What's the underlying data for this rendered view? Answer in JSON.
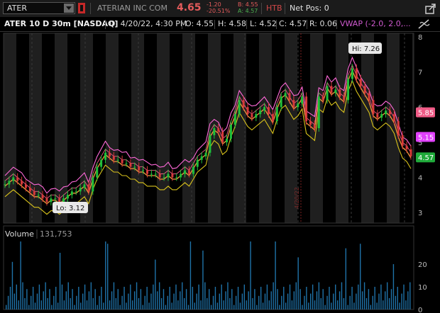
{
  "header": {
    "symbol": "ATER",
    "company": "ATERIAN INC COM",
    "last_price": "4.65",
    "change": "-1.20",
    "change_pct": "-20.51%",
    "bid": "B: 4.55",
    "ask": "A: 4.57",
    "htb": "HTB",
    "net_pos": "Net Pos: 0"
  },
  "info": {
    "title": "ATER 10 D 30m [NASDAQ]",
    "date": "D: 4/20/22, 4:30 PM",
    "open": "O: 4.55",
    "high": "H: 4.58",
    "low": "L: 4.52",
    "close": "C: 4.57",
    "range": "R: 0.06",
    "vwap": "VWAP (-2.0, 2.0,..."
  },
  "colors": {
    "up": "#1fbf3a",
    "down": "#d83a3a",
    "vwap": "#ff69d9",
    "orange": "#f39a3c",
    "yellow": "#d8c21c",
    "pink": "#f05a86",
    "cyan": "#1f72a8",
    "badge_pink": "#f05a86",
    "badge_magenta": "#e040fb",
    "badge_green": "#1faa3a"
  },
  "chart_data": [
    {
      "type": "line",
      "title": "ATER 10 D 30m [NASDAQ]",
      "ylim": [
        2.7,
        8.1
      ],
      "yticks": [
        3,
        4,
        5,
        6,
        7,
        8
      ],
      "x": [
        0,
        6,
        12,
        18,
        24,
        30,
        36,
        42,
        48,
        54,
        60,
        66,
        72,
        78,
        84,
        90,
        96,
        102,
        108,
        114,
        120,
        126,
        132,
        138,
        144,
        150,
        156,
        162,
        168,
        174,
        180,
        186,
        192,
        198,
        204,
        210,
        216,
        222,
        228,
        234,
        240,
        246,
        252,
        258,
        264,
        270,
        276,
        282,
        288,
        294,
        300,
        306,
        312,
        318,
        324,
        330,
        336,
        342,
        348,
        354,
        360,
        366,
        372,
        378,
        384,
        390,
        396,
        402,
        408,
        414,
        420,
        426,
        432,
        438,
        444,
        450,
        456,
        462,
        468,
        474,
        480,
        486,
        492,
        498,
        504,
        510,
        516,
        522,
        528,
        534,
        540,
        546,
        552,
        558,
        564,
        570,
        576,
        582
      ],
      "series": [
        {
          "values": [
            3.8,
            3.9,
            4.0,
            3.9,
            3.8,
            3.7,
            3.6,
            3.5,
            3.5,
            3.4,
            3.3,
            3.4,
            3.4,
            3.3,
            3.4,
            3.5,
            3.6,
            3.6,
            3.7,
            3.8,
            3.6,
            4.0,
            4.3,
            4.5,
            4.7,
            4.6,
            4.5,
            4.5,
            4.4,
            4.4,
            4.3,
            4.3,
            4.2,
            4.2,
            4.1,
            4.1,
            4.1,
            4.0,
            4.0,
            4.1,
            4.0,
            4.0,
            4.1,
            4.2,
            4.1,
            4.3,
            4.5,
            4.6,
            4.7,
            5.2,
            5.4,
            5.3,
            5.0,
            5.1,
            5.5,
            5.8,
            6.2,
            6.0,
            5.8,
            5.7,
            5.8,
            5.9,
            6.0,
            5.8,
            5.6,
            6.0,
            6.3,
            6.4,
            6.2,
            6.0,
            6.1,
            6.3,
            5.6,
            5.5,
            5.4,
            6.3,
            6.2,
            6.6,
            6.4,
            6.5,
            6.3,
            6.2,
            6.8,
            7.1,
            6.8,
            6.6,
            6.4,
            6.2,
            5.8,
            5.7,
            5.8,
            5.9,
            5.8,
            5.6,
            5.2,
            4.9,
            4.8,
            4.6
          ]
        }
      ]
    },
    {
      "type": "bar",
      "title": "Volume",
      "ylim": [
        0,
        30
      ],
      "yticks": [
        0,
        10,
        20
      ],
      "values": [
        131753
      ]
    }
  ],
  "price_badges": [
    {
      "label": "5.85",
      "y": 5.85,
      "color": "#f05a86"
    },
    {
      "label": "5.15",
      "y": 5.15,
      "color": "#e040fb"
    },
    {
      "label": "4.57",
      "y": 4.57,
      "color": "#1faa3a"
    }
  ],
  "callouts": {
    "hi": "Hi: 7.26",
    "lo": "Lo: 3.12"
  },
  "cursor_label": "4/20/22",
  "volume_panel": {
    "title": "Volume",
    "value": "131,753"
  }
}
